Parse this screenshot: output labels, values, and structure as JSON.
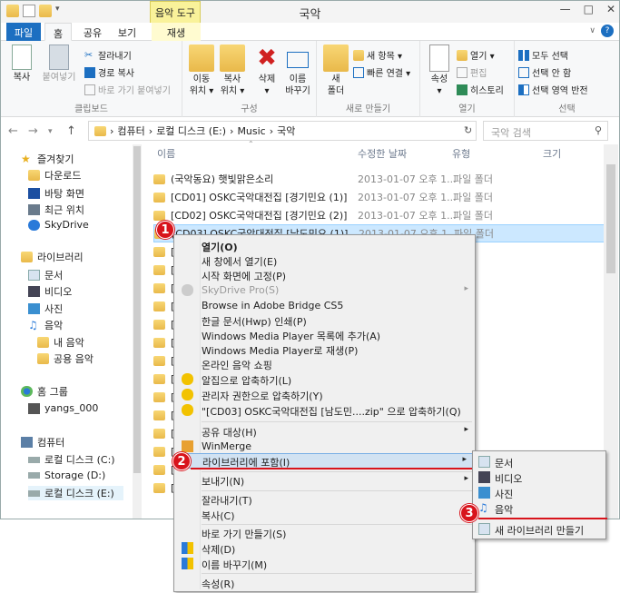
{
  "window": {
    "title": "국악"
  },
  "context_tab": {
    "label": "음악 도구"
  },
  "tabs": {
    "file": "파일",
    "home": "홈",
    "share": "공유",
    "view": "보기",
    "play": "재생"
  },
  "ribbon": {
    "clipboard": {
      "label": "클립보드",
      "copy": "복사",
      "paste": "붙여넣기",
      "cut": "잘라내기",
      "copy_path": "경로 복사",
      "paste_shortcut": "바로 가기 붙여넣기"
    },
    "organize": {
      "label": "구성",
      "move_to": "이동\n위치 ▾",
      "copy_to": "복사\n위치 ▾",
      "delete": "삭제\n▾",
      "rename": "이름\n바꾸기"
    },
    "new": {
      "label": "새로 만들기",
      "new_folder": "새\n폴더",
      "new_item": "새 항목 ▾",
      "easy_access": "빠른 연결 ▾"
    },
    "open": {
      "label": "열기",
      "properties": "속성\n▾",
      "open": "열기 ▾",
      "edit": "편집",
      "history": "히스토리"
    },
    "select": {
      "label": "선택",
      "select_all": "모두 선택",
      "select_none": "선택 안 함",
      "invert": "선택 영역 반전"
    }
  },
  "address": {
    "crumbs": [
      "컴퓨터",
      "로컬 디스크 (E:)",
      "Music",
      "국악"
    ],
    "search_placeholder": "국악 검색"
  },
  "nav": {
    "favorites": "즐겨찾기",
    "downloads": "다운로드",
    "desktop": "바탕 화면",
    "recent": "최근 위치",
    "skydrive": "SkyDrive",
    "libraries": "라이브러리",
    "documents": "문서",
    "videos": "비디오",
    "pictures": "사진",
    "music": "음악",
    "my_music": "내 음악",
    "public_music": "공용 음악",
    "homegroup": "홈 그룹",
    "user": "yangs_000",
    "computer": "컴퓨터",
    "drive_c": "로컬 디스크 (C:)",
    "drive_d": "Storage (D:)",
    "drive_e": "로컬 디스크 (E:)"
  },
  "columns": {
    "name": "이름",
    "date": "수정한 날짜",
    "type": "유형",
    "size": "크기"
  },
  "files": [
    {
      "name": "(국악동요) 햇빛맑은소리",
      "date": "2013-01-07 오후 1...",
      "type": "파일 폴더"
    },
    {
      "name": "[CD01] OSKC국악대전집 [경기민요 (1)]",
      "date": "2013-01-07 오후 1...",
      "type": "파일 폴더"
    },
    {
      "name": "[CD02] OSKC국악대전집 [경기민요 (2)]",
      "date": "2013-01-07 오후 1...",
      "type": "파일 폴더"
    },
    {
      "name": "[CD03] OSKC국악대전집 [남도민요 (1)]",
      "date": "2013-01-07 오후 1...",
      "type": "파일 폴더"
    },
    {
      "name": "["
    },
    {
      "name": "["
    },
    {
      "name": "["
    },
    {
      "name": "["
    },
    {
      "name": "["
    },
    {
      "name": "["
    },
    {
      "name": "["
    },
    {
      "name": "["
    },
    {
      "name": "["
    },
    {
      "name": "["
    },
    {
      "name": "["
    },
    {
      "name": "["
    },
    {
      "name": "["
    },
    {
      "name": "["
    }
  ],
  "context_menu": {
    "open": "열기(O)",
    "open_new_window": "새 창에서 열기(E)",
    "pin_start": "시작 화면에 고정(P)",
    "skydrive_pro": "SkyDrive Pro(S)",
    "bridge": "Browse in Adobe Bridge CS5",
    "hwp_print": "한글 문서(Hwp) 인쇄(P)",
    "wmp_add": "Windows Media Player 목록에 추가(A)",
    "wmp_play": "Windows Media Player로 재생(P)",
    "online_music": "온라인 음악 쇼핑",
    "alzip": "알집으로 압축하기(L)",
    "alzip_admin": "관리자 권한으로 압축하기(Y)",
    "alzip_named": "\"[CD03] OSKC국악대전집 [남도민....zip\" 으로 압축하기(Q)",
    "share_with": "공유 대상(H)",
    "winmerge": "WinMerge",
    "include_library": "라이브러리에 포함(I)",
    "send_to": "보내기(N)",
    "cut": "잘라내기(T)",
    "copy": "복사(C)",
    "create_shortcut": "바로 가기 만들기(S)",
    "delete": "삭제(D)",
    "rename": "이름 바꾸기(M)",
    "properties": "속성(R)"
  },
  "submenu": {
    "documents": "문서",
    "videos": "비디오",
    "pictures": "사진",
    "music": "음악",
    "new_library": "새 라이브러리 만들기"
  },
  "badges": [
    "1",
    "2",
    "3"
  ],
  "colors": {
    "accent": "#1c6fc1",
    "selection": "#cce8ff",
    "badge": "#d8141c",
    "context_tab": "#f9f29a"
  }
}
